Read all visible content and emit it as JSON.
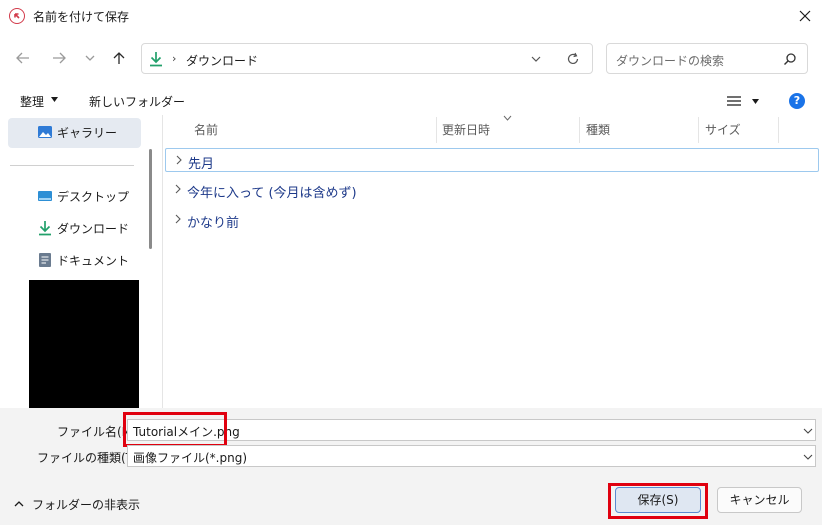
{
  "window": {
    "title": "名前を付けて保存"
  },
  "address": {
    "path": "ダウンロード"
  },
  "search": {
    "placeholder": "ダウンロードの検索"
  },
  "toolbar": {
    "organize_label": "整理",
    "new_folder_label": "新しいフォルダー"
  },
  "sidebar": {
    "items": [
      {
        "label": "ギャラリー"
      },
      {
        "label": "デスクトップ"
      },
      {
        "label": "ダウンロード"
      },
      {
        "label": "ドキュメント"
      }
    ]
  },
  "file_list": {
    "columns": [
      "名前",
      "更新日時",
      "種類",
      "サイズ"
    ],
    "groups": [
      "先月",
      "今年に入って (今月は含めず)",
      "かなり前"
    ]
  },
  "form": {
    "filename_label": "ファイル名(N):",
    "filename_value": "Tutorialメイン.png",
    "filetype_label": "ファイルの種類(T):",
    "filetype_value": "画像ファイル(*.png)",
    "hide_folders_label": "フォルダーの非表示"
  },
  "buttons": {
    "save_label": "保存(S)",
    "cancel_label": "キャンセル"
  },
  "colors": {
    "highlight": "#e0000f",
    "accent": "#1a73e8",
    "group_text": "#1e3a8a",
    "download_icon": "#22a06b"
  }
}
